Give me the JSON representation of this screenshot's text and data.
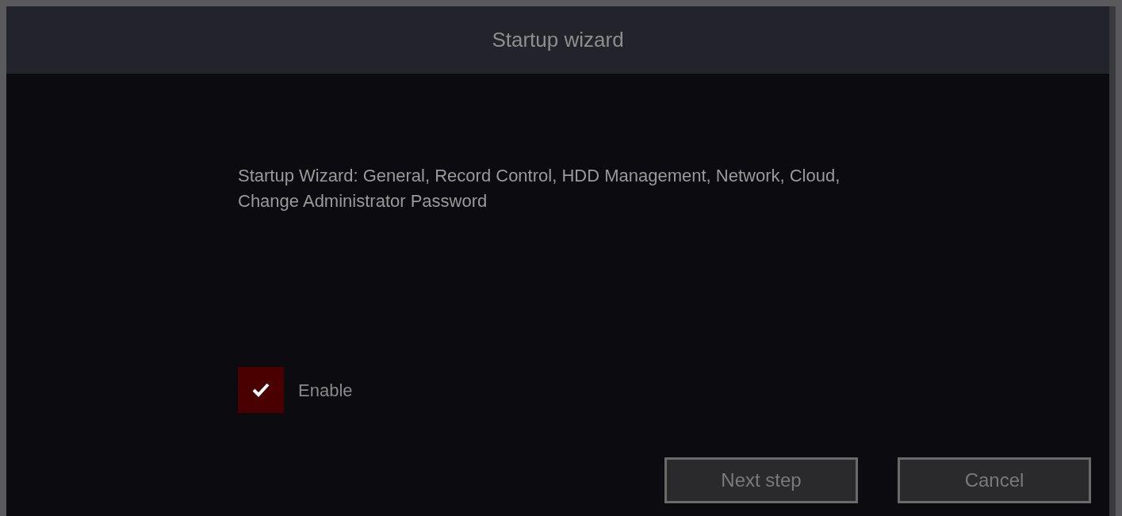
{
  "window": {
    "title": "Startup wizard"
  },
  "description": "Startup Wizard: General, Record Control, HDD Management, Network, Cloud, Change Administrator Password",
  "enable": {
    "label": "Enable",
    "checked": true
  },
  "buttons": [
    {
      "label": "Next step"
    },
    {
      "label": "Cancel"
    }
  ]
}
